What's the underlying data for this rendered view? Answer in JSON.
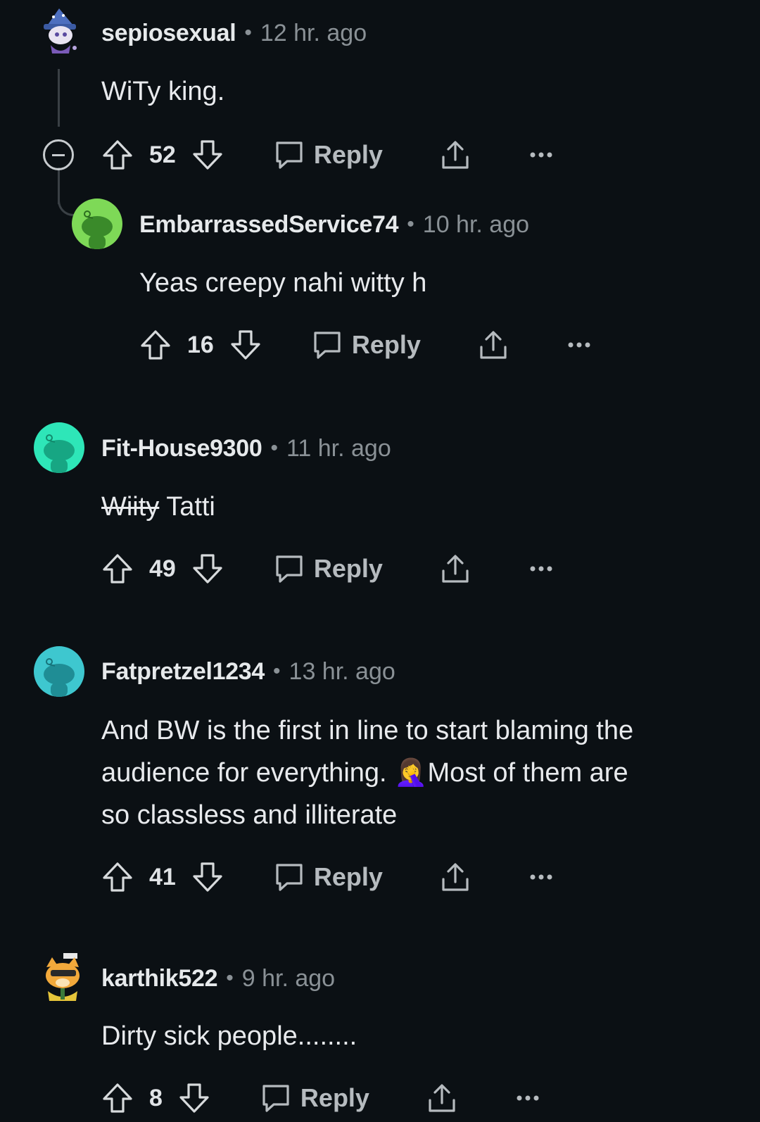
{
  "colors": {
    "background": "#0b1014",
    "username": "#e6e9eb",
    "meta": "#8a9196",
    "action": "#b6bbbf",
    "avatar_green": "#7ed957",
    "avatar_teal": "#2ee6b8",
    "avatar_cyan": "#3ec7cf"
  },
  "comments": [
    {
      "username": "sepiosexual",
      "time": "12 hr. ago",
      "body": "WiTy king.",
      "score": "52",
      "reply_label": "Reply",
      "avatar_icon": "wizard-avatar-icon"
    },
    {
      "username": "EmbarrassedService74",
      "time": "10 hr. ago",
      "body": "Yeas creepy nahi witty h",
      "score": "16",
      "reply_label": "Reply",
      "avatar_icon": "snoo-avatar-icon"
    },
    {
      "username": "Fit-House9300",
      "time": "11 hr. ago",
      "body_struck": "Wiity",
      "body": "Tatti",
      "score": "49",
      "reply_label": "Reply",
      "avatar_icon": "snoo-avatar-icon"
    },
    {
      "username": "Fatpretzel1234",
      "time": "13 hr. ago",
      "body_line1": "And BW is the first in line to start blaming the",
      "body_line2a": "audience for everything.",
      "body_emoji": "🤦‍♀️",
      "body_line2b": "Most of them are",
      "body_line3": "so classless and illiterate",
      "score": "41",
      "reply_label": "Reply",
      "avatar_icon": "snoo-avatar-icon"
    },
    {
      "username": "karthik522",
      "time": "9 hr. ago",
      "body": "Dirty sick people........",
      "score": "8",
      "reply_label": "Reply",
      "avatar_icon": "cat-avatar-icon"
    }
  ],
  "separator": "•"
}
